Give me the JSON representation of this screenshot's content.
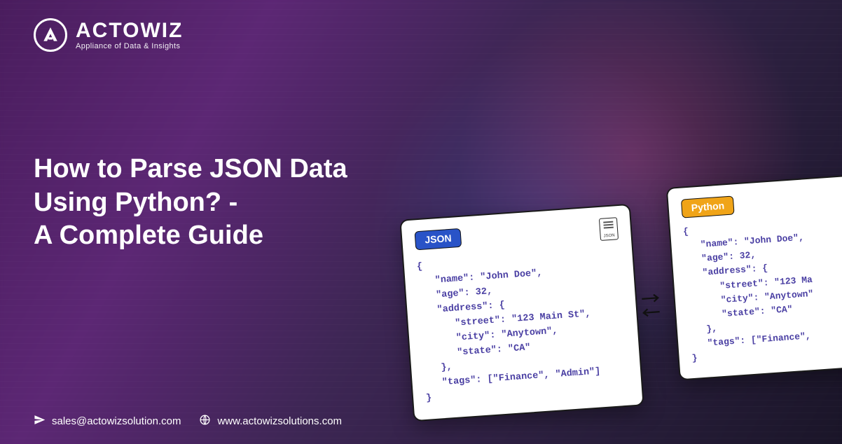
{
  "brand": {
    "name": "ACTOWIZ",
    "tagline": "Appliance of Data & Insights"
  },
  "headline": {
    "line1": "How to Parse JSON Data",
    "line2": "Using Python? -",
    "line3": "A Complete Guide"
  },
  "contact": {
    "email": "sales@actowizsolution.com",
    "website": "www.actowizsolutions.com"
  },
  "cards": {
    "json": {
      "label": "JSON",
      "file_tag": "JSON",
      "code": "{\n   \"name\": \"John Doe\",\n   \"age\": 32,\n   \"address\": {\n      \"street\": \"123 Main St\",\n      \"city\": \"Anytown\",\n      \"state\": \"CA\"\n   },\n   \"tags\": [\"Finance\", \"Admin\"]\n}"
    },
    "python": {
      "label": "Python",
      "code": "{\n   \"name\": \"John Doe\",\n   \"age\": 32,\n   \"address\": {\n      \"street\": \"123 Ma\n      \"city\": \"Anytown\"\n      \"state\": \"CA\"\n   },\n   \"tags\": [\"Finance\",\n}"
    }
  }
}
